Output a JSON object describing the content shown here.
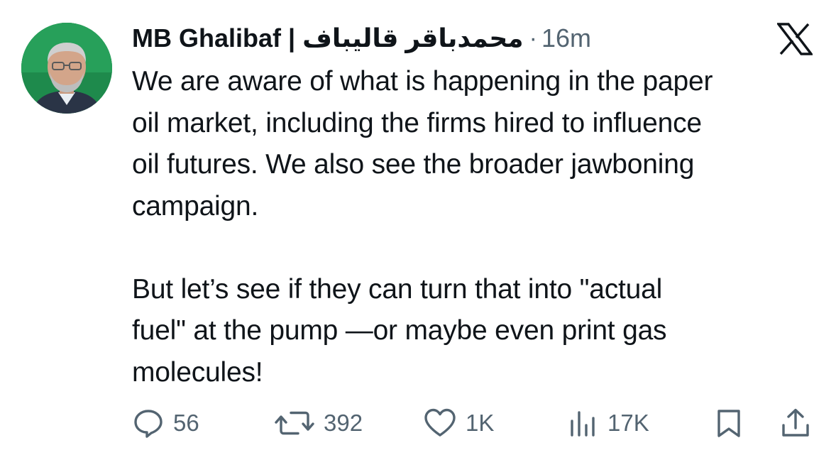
{
  "post": {
    "author": {
      "display_name": "MB Ghalibaf | محمدباقر قالیباف",
      "avatar_icon": "profile-photo"
    },
    "separator": "·",
    "timestamp": "16m",
    "platform_icon": "x-logo-icon",
    "text_lines": [
      "We are aware of what is happening in the paper",
      "oil market, including the firms hired to influence",
      "oil futures. We also see the broader jawboning",
      "campaign.",
      "",
      "But let’s see if they can turn that into \"actual",
      "fuel\" at the pump —or maybe even print gas",
      "molecules!"
    ]
  },
  "actions": {
    "replies": {
      "icon": "reply-icon",
      "count": "56"
    },
    "reposts": {
      "icon": "repost-icon",
      "count": "392"
    },
    "likes": {
      "icon": "heart-icon",
      "count": "1K"
    },
    "views": {
      "icon": "views-chart-icon",
      "count": "17K"
    },
    "bookmark": {
      "icon": "bookmark-icon"
    },
    "share": {
      "icon": "share-icon"
    }
  },
  "colors": {
    "text_primary": "#0f1419",
    "text_secondary": "#536471",
    "avatar_background": "#1e8a4c"
  }
}
